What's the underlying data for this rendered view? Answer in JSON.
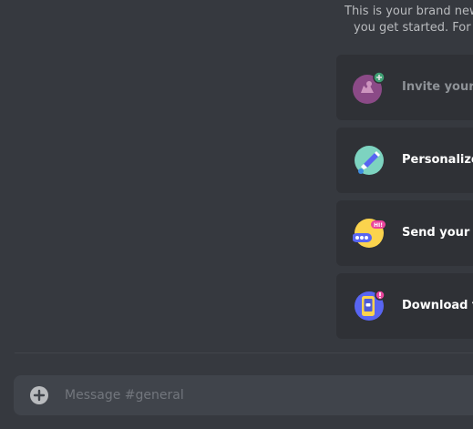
{
  "intro": {
    "line1": "This is your brand new,",
    "line2": "you get started. For mo"
  },
  "cards": [
    {
      "label": "Invite your fri",
      "icon": "invite-friends-icon",
      "completed": true
    },
    {
      "label": "Personalize y",
      "icon": "paint-brush-icon",
      "completed": false
    },
    {
      "label": "Send your firs",
      "icon": "chat-bubble-icon",
      "completed": false
    },
    {
      "label": "Download the",
      "icon": "mobile-app-icon",
      "completed": false
    }
  ],
  "composer": {
    "placeholder": "Message #general",
    "value": ""
  },
  "colors": {
    "background": "#36393f",
    "card": "#2f3136",
    "input": "#40444b",
    "invite_purple": "#9c4f96",
    "personalize_teal": "#7dd3c0",
    "send_yellow": "#fbd34d",
    "download_blue": "#5865f2"
  }
}
